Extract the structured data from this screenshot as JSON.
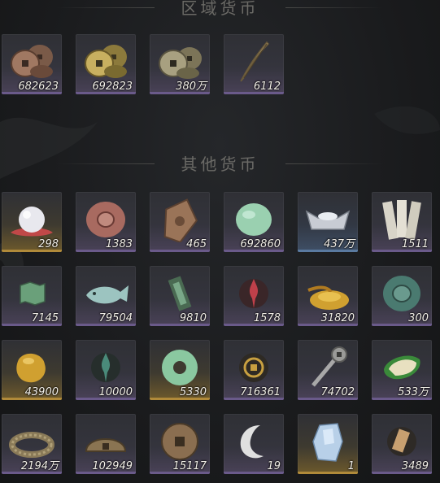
{
  "sections": [
    {
      "title": "区域货币"
    },
    {
      "title": "其他货币"
    }
  ],
  "regional": [
    {
      "icon": "copper-coin-stack-icon",
      "count": "682623",
      "rarity": "purple"
    },
    {
      "icon": "brass-coin-stack-icon",
      "count": "692823",
      "rarity": "purple"
    },
    {
      "icon": "old-coin-stack-icon",
      "count": "380万",
      "rarity": "purple"
    },
    {
      "icon": "feather-blade-icon",
      "count": "6112",
      "rarity": "purple"
    }
  ],
  "other": [
    {
      "icon": "pearl-icon",
      "count": "298",
      "rarity": "gold"
    },
    {
      "icon": "red-jade-disc-icon",
      "count": "1383",
      "rarity": "purple"
    },
    {
      "icon": "carved-bronze-plaque-icon",
      "count": "465",
      "rarity": "purple"
    },
    {
      "icon": "green-jade-stone-icon",
      "count": "692860",
      "rarity": "purple"
    },
    {
      "icon": "silver-ingot-icon",
      "count": "437万",
      "rarity": "blue"
    },
    {
      "icon": "paper-talisman-icon",
      "count": "1511",
      "rarity": "purple"
    },
    {
      "icon": "jade-map-token-icon",
      "count": "7145",
      "rarity": "purple"
    },
    {
      "icon": "jade-fish-icon",
      "count": "79504",
      "rarity": "purple"
    },
    {
      "icon": "jade-tablet-icon",
      "count": "9810",
      "rarity": "purple"
    },
    {
      "icon": "red-flame-emblem-icon",
      "count": "1578",
      "rarity": "purple"
    },
    {
      "icon": "golden-grain-pile-icon",
      "count": "31820",
      "rarity": "purple"
    },
    {
      "icon": "jade-green-disc-icon",
      "count": "300",
      "rarity": "purple"
    },
    {
      "icon": "gold-nugget-icon",
      "count": "43900",
      "rarity": "gold"
    },
    {
      "icon": "green-flame-emblem-icon",
      "count": "10000",
      "rarity": "purple"
    },
    {
      "icon": "jade-bi-ring-icon",
      "count": "5330",
      "rarity": "gold"
    },
    {
      "icon": "gold-coin-emblem-icon",
      "count": "716361",
      "rarity": "purple"
    },
    {
      "icon": "coin-sword-icon",
      "count": "74702",
      "rarity": "purple"
    },
    {
      "icon": "melon-icon",
      "count": "533万",
      "rarity": "purple"
    },
    {
      "icon": "coin-string-icon",
      "count": "2194万",
      "rarity": "purple"
    },
    {
      "icon": "half-bronze-disc-icon",
      "count": "102949",
      "rarity": "purple"
    },
    {
      "icon": "large-bronze-coin-icon",
      "count": "15117",
      "rarity": "purple"
    },
    {
      "icon": "crescent-moon-icon",
      "count": "19",
      "rarity": "purple"
    },
    {
      "icon": "crystal-shard-icon",
      "count": "1",
      "rarity": "gold"
    },
    {
      "icon": "wrapped-scroll-icon",
      "count": "3489",
      "rarity": "purple"
    }
  ]
}
